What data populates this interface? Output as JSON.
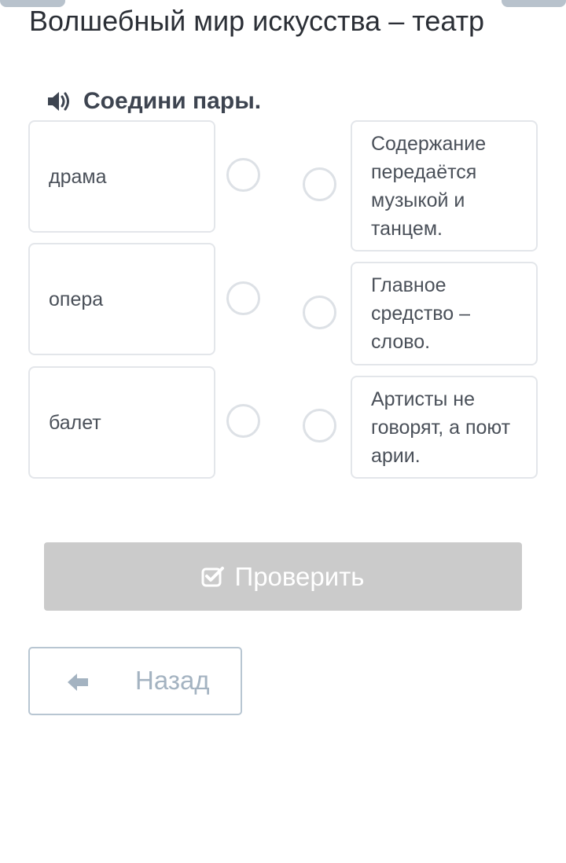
{
  "header": {
    "title": "Волшебный мир искусства – театр"
  },
  "task": {
    "instruction": "Соедини пары."
  },
  "left_items": [
    {
      "label": "драма"
    },
    {
      "label": "опера"
    },
    {
      "label": "балет"
    }
  ],
  "right_items": [
    {
      "label": "Содержание передаётся музыкой и танцем."
    },
    {
      "label": "Главное средство – слово."
    },
    {
      "label": "Артисты не говорят, а поют арии."
    }
  ],
  "actions": {
    "check_label": "Проверить",
    "back_label": "Назад"
  },
  "colors": {
    "check_button_bg": "#cbcbcb",
    "back_button_border": "#b8c6d2",
    "card_border": "#e3e6ea"
  },
  "icons": {
    "speaker": "speaker-icon",
    "check": "checkbox-check-icon",
    "back": "arrow-left-icon"
  }
}
